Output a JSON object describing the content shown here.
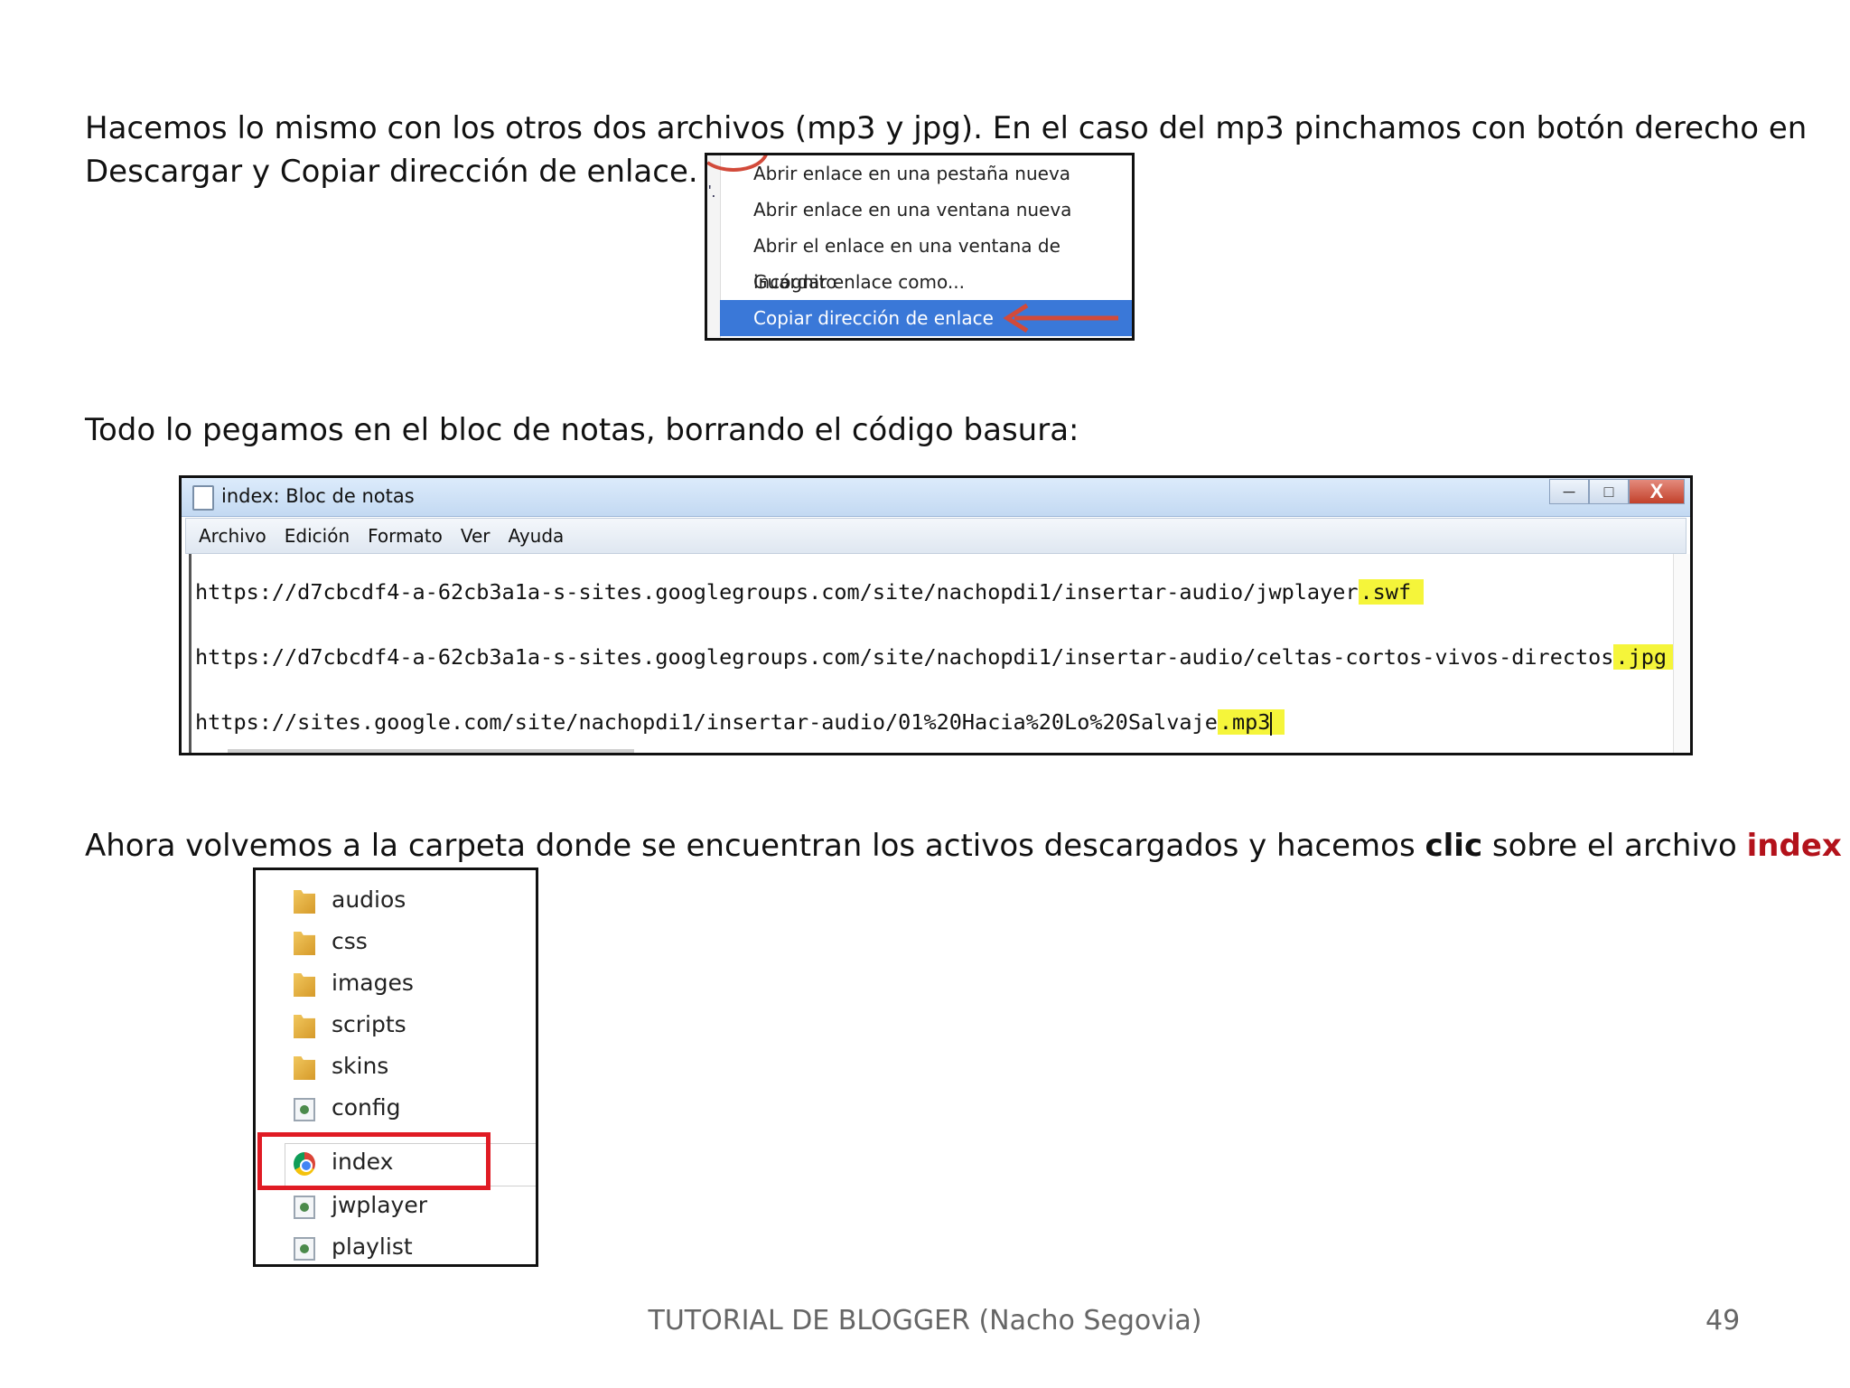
{
  "paragraph1": {
    "line1": "Hacemos lo mismo con los otros dos archivos (mp3 y jpg). En el caso del mp3 pinchamos con botón derecho en",
    "line2": "Descargar y Copiar dirección de enlace."
  },
  "context_menu": {
    "items": [
      "Abrir enlace en una pestaña nueva",
      "Abrir enlace en una ventana nueva",
      "Abrir el enlace en una ventana de incógnito",
      "Guardar enlace como...",
      "Copiar dirección de enlace"
    ],
    "selected_index": 4,
    "highlight_color": "#3a78d8"
  },
  "paragraph2": "Todo lo pegamos en el bloc de notas, borrando el código basura:",
  "notepad": {
    "title": "index: Bloc de notas",
    "menu": [
      "Archivo",
      "Edición",
      "Formato",
      "Ver",
      "Ayuda"
    ],
    "lines": [
      {
        "prefix": "https://d7cbcdf4-a-62cb3a1a-s-sites.googlegroups.com/site/nachopdi1/insertar-audio/jwplayer",
        "highlight": ".swf"
      },
      {
        "prefix": "https://d7cbcdf4-a-62cb3a1a-s-sites.googlegroups.com/site/nachopdi1/insertar-audio/celtas-cortos-vivos-directos",
        "highlight": ".jpg"
      },
      {
        "prefix": "https://sites.google.com/site/nachopdi1/insertar-audio/01%20Hacia%20Lo%20Salvaje",
        "highlight": ".mp3"
      }
    ],
    "highlight_color": "#f5f53a",
    "close_label": "X"
  },
  "paragraph3": {
    "part1": "Ahora volvemos a la carpeta donde se encuentran los activos descargados y hacemos ",
    "bold": "clic",
    "part2": " sobre el archivo ",
    "red": "index",
    "red_color": "#b3121b"
  },
  "explorer": {
    "items": [
      {
        "name": "audios",
        "icon": "folder-icon"
      },
      {
        "name": "css",
        "icon": "folder-icon"
      },
      {
        "name": "images",
        "icon": "folder-icon"
      },
      {
        "name": "scripts",
        "icon": "folder-icon"
      },
      {
        "name": "skins",
        "icon": "folder-icon"
      },
      {
        "name": "config",
        "icon": "file-icon"
      },
      {
        "name": "index",
        "icon": "chrome-icon"
      },
      {
        "name": "jwplayer",
        "icon": "file-icon"
      },
      {
        "name": "playlist",
        "icon": "file-icon"
      }
    ],
    "highlighted_index": 6,
    "highlight_color": "#e01b24"
  },
  "footer": {
    "text": "TUTORIAL DE BLOGGER (Nacho Segovia)",
    "page_number": "49"
  }
}
